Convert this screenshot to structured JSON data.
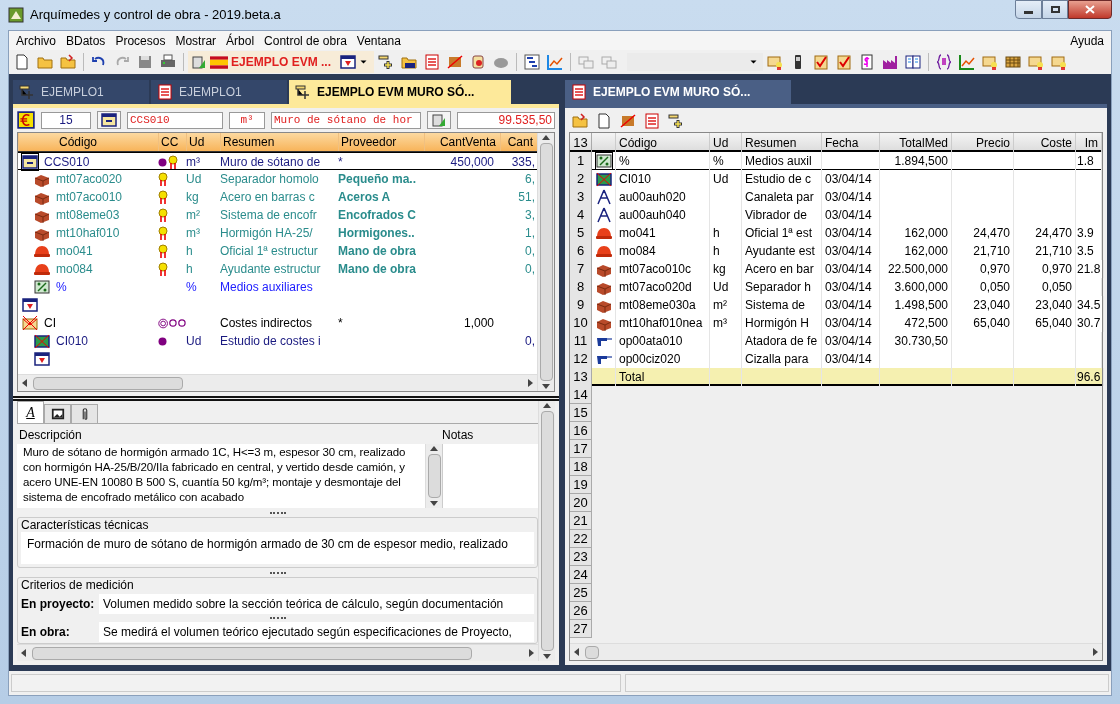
{
  "window": {
    "title": "Arquímedes y control de obra - 2019.beta.a"
  },
  "menu": {
    "items": [
      "Archivo",
      "BDatos",
      "Procesos",
      "Mostrar",
      "Árbol",
      "Control de obra",
      "Ventana"
    ],
    "help": "Ayuda"
  },
  "toolbar": {
    "project": "EJEMPLO EVM ..."
  },
  "left_tabs": [
    {
      "kind": "tree",
      "label": "EJEMPLO1",
      "selected": false
    },
    {
      "kind": "sheet",
      "label": "EJEMPLO1",
      "selected": false
    },
    {
      "kind": "tree",
      "label": "EJEMPLO EVM MURO SÓ...",
      "selected": true
    }
  ],
  "fields": {
    "count": "15",
    "code": "CCS010",
    "unit": "m³",
    "summary": "Muro de sótano de hor",
    "amount": "99.535,50"
  },
  "tree": {
    "columns": [
      "Código",
      "CC",
      "Ud",
      "Resumen",
      "Proveedor",
      "CantVenta",
      "Cant"
    ],
    "rows": [
      {
        "kind": "chapter",
        "code": "CCS010",
        "cc": [
          {
            "kind": "dot"
          },
          {
            "kind": "ribbon"
          }
        ],
        "ud": "m³",
        "summary": "Muro de sótano de",
        "supplier": "*",
        "sale_qty": "450,000",
        "qty": "335,",
        "selected": true,
        "children": [
          {
            "kind": "material",
            "code": "mt07aco020",
            "cc": [
              {
                "kind": "ribbon"
              }
            ],
            "ud": "Ud",
            "summary": "Separador homolo",
            "supplier": "Pequeño ma..",
            "qty": "6,",
            "selected": false
          },
          {
            "kind": "material",
            "code": "mt07aco010",
            "cc": [
              {
                "kind": "ribbon"
              }
            ],
            "ud": "kg",
            "summary": "Acero en barras c",
            "supplier": "Aceros A",
            "qty": "51,",
            "selected": false
          },
          {
            "kind": "material",
            "code": "mt08eme03",
            "cc": [
              {
                "kind": "ribbon"
              }
            ],
            "ud": "m²",
            "summary": "Sistema de encofr",
            "supplier": "Encofrados C",
            "qty": "3,",
            "selected": false
          },
          {
            "kind": "material",
            "code": "mt10haf010",
            "cc": [
              {
                "kind": "ribbon"
              }
            ],
            "ud": "m³",
            "summary": "Hormigón HA-25/",
            "supplier": "Hormigones..",
            "qty": "1,",
            "selected": false
          },
          {
            "kind": "labour",
            "code": "mo041",
            "cc": [
              {
                "kind": "ribbon"
              }
            ],
            "ud": "h",
            "summary": "Oficial 1ª estructur",
            "supplier": "Mano de obra",
            "qty": "0,",
            "selected": false
          },
          {
            "kind": "labour",
            "code": "mo084",
            "cc": [
              {
                "kind": "ribbon"
              }
            ],
            "ud": "h",
            "summary": "Ayudante estructur",
            "supplier": "Mano de obra",
            "qty": "0,",
            "selected": false
          },
          {
            "kind": "percent",
            "code": "%",
            "ud": "%",
            "summary": "Medios auxiliares",
            "selected": false
          }
        ]
      },
      {
        "kind": "end",
        "selected": false
      },
      {
        "kind": "indirect",
        "code": "CI",
        "cc": [
          {
            "kind": "double-ring"
          },
          {
            "kind": "ring"
          },
          {
            "kind": "ring"
          }
        ],
        "summary": "Costes indirectos",
        "supplier": "*",
        "sale_qty": "1,000",
        "selected": false,
        "children": [
          {
            "kind": "indirect-item",
            "code": "CI010",
            "cc": [
              {
                "kind": "dot"
              }
            ],
            "ud": "Ud",
            "summary": "Estudio de costes i",
            "qty": "0,",
            "selected": false
          },
          {
            "kind": "end",
            "selected": false
          }
        ]
      }
    ]
  },
  "detail_tabs": [
    {
      "kind": "text",
      "label": "A",
      "selected": true
    },
    {
      "kind": "image",
      "selected": false
    },
    {
      "kind": "attachment",
      "selected": false
    }
  ],
  "detail": {
    "description_label": "Descripción",
    "notes_label": "Notas",
    "description": "Muro de sótano de hormigón armado 1C, H<=3 m, espesor 30 cm, realizado con hormigón HA-25/B/20/IIa fabricado en central, y vertido desde camión, y acero UNE-EN 10080 B 500 S, cuantía 50 kg/m³; montaje y desmontaje del sistema de encofrado metálico con acabado",
    "tech_label": "Características técnicas",
    "tech": "Formación de muro de sótano de hormigón armado de 30 cm de espesor medio, realizado",
    "criteria_label": "Criterios de medición",
    "project_label": "En proyecto:",
    "project": "Volumen medido sobre la sección teórica de cálculo, según documentación",
    "site_label": "En obra:",
    "site": "Se medirá el volumen teórico ejecutado según especificaciones de Proyecto,"
  },
  "right_tab": {
    "label": "EJEMPLO EVM MURO SÓ..."
  },
  "table": {
    "corner": "13",
    "columns": [
      "Código",
      "Ud",
      "Resumen",
      "Fecha",
      "TotalMed",
      "Precio",
      "Coste",
      "Im"
    ],
    "rows": [
      {
        "number": "1",
        "kind": "percent",
        "code": "%",
        "ud": "%",
        "summary": "Medios auxil",
        "total": "1.894,500",
        "amount": "1.8",
        "selected": true
      },
      {
        "number": "2",
        "kind": "indirect-item",
        "code": "CI010",
        "ud": "Ud",
        "summary": "Estudio de c",
        "date": "03/04/14",
        "selected": false
      },
      {
        "number": "3",
        "kind": "compass",
        "code": "au00auh020",
        "summary": "Canaleta par",
        "date": "03/04/14",
        "selected": false
      },
      {
        "number": "4",
        "kind": "compass",
        "code": "au00auh040",
        "summary": "Vibrador de",
        "date": "03/04/14",
        "selected": false
      },
      {
        "number": "5",
        "kind": "labour",
        "code": "mo041",
        "ud": "h",
        "summary": "Oficial 1ª est",
        "date": "03/04/14",
        "total": "162,000",
        "price": "24,470",
        "cost": "24,470",
        "amount": "3.9",
        "selected": false
      },
      {
        "number": "6",
        "kind": "labour",
        "code": "mo084",
        "ud": "h",
        "summary": "Ayudante est",
        "date": "03/04/14",
        "total": "162,000",
        "price": "21,710",
        "cost": "21,710",
        "amount": "3.5",
        "selected": false
      },
      {
        "number": "7",
        "kind": "material",
        "code": "mt07aco010c",
        "ud": "kg",
        "summary": "Acero en bar",
        "date": "03/04/14",
        "total": "22.500,000",
        "price": "0,970",
        "cost": "0,970",
        "amount": "21.8",
        "selected": false
      },
      {
        "number": "8",
        "kind": "material",
        "code": "mt07aco020d",
        "ud": "Ud",
        "summary": "Separador h",
        "date": "03/04/14",
        "total": "3.600,000",
        "price": "0,050",
        "cost": "0,050",
        "selected": false
      },
      {
        "number": "9",
        "kind": "material",
        "code": "mt08eme030a",
        "ud": "m²",
        "summary": "Sistema de",
        "date": "03/04/14",
        "total": "1.498,500",
        "price": "23,040",
        "cost": "23,040",
        "amount": "34.5",
        "selected": false
      },
      {
        "number": "10",
        "kind": "material",
        "code": "mt10haf010nea",
        "ud": "m³",
        "summary": "Hormigón H",
        "date": "03/04/14",
        "total": "472,500",
        "price": "65,040",
        "cost": "65,040",
        "amount": "30.7",
        "selected": false
      },
      {
        "number": "11",
        "kind": "tool",
        "code": "op00ata010",
        "summary": "Atadora de fe",
        "date": "03/04/14",
        "total": "30.730,50",
        "selected": false
      },
      {
        "number": "12",
        "kind": "tool",
        "code": "op00ciz020",
        "summary": "Cizalla para",
        "date": "03/04/14",
        "selected": false
      },
      {
        "number": "13",
        "kind": "total",
        "code": "Total",
        "amount": "96.6",
        "selected": false
      }
    ],
    "empty_rows": [
      "14",
      "15",
      "16",
      "17",
      "18",
      "19",
      "20",
      "21",
      "22",
      "23",
      "24",
      "25",
      "26",
      "27"
    ]
  }
}
